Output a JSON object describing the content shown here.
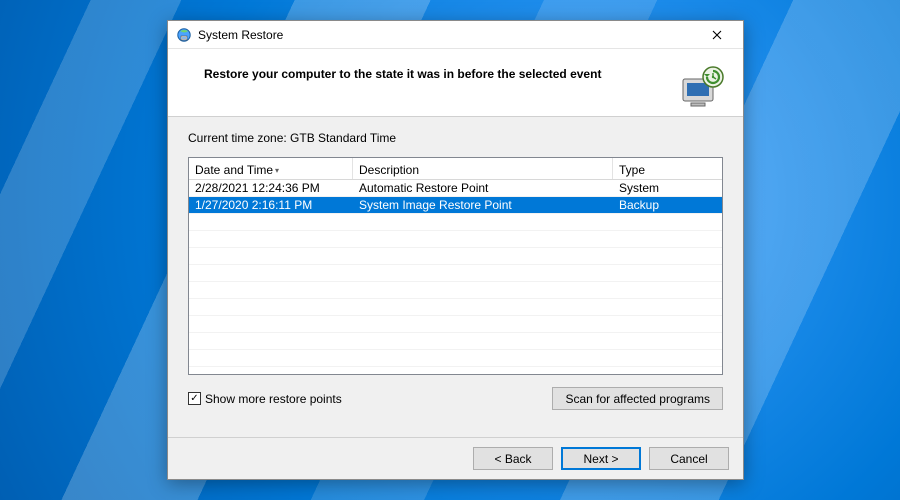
{
  "window": {
    "title": "System Restore"
  },
  "header": {
    "heading": "Restore your computer to the state it was in before the selected event"
  },
  "content": {
    "timezone_label": "Current time zone: GTB Standard Time",
    "columns": {
      "date": "Date and Time",
      "desc": "Description",
      "type": "Type"
    },
    "rows": [
      {
        "date": "2/28/2021 12:24:36 PM",
        "desc": "Automatic Restore Point",
        "type": "System",
        "selected": false
      },
      {
        "date": "1/27/2020 2:16:11 PM",
        "desc": "System Image Restore Point",
        "type": "Backup",
        "selected": true
      }
    ],
    "show_more": {
      "label": "Show more restore points",
      "checked": true
    },
    "scan_button": "Scan for affected programs"
  },
  "footer": {
    "back": "< Back",
    "next": "Next >",
    "cancel": "Cancel"
  }
}
